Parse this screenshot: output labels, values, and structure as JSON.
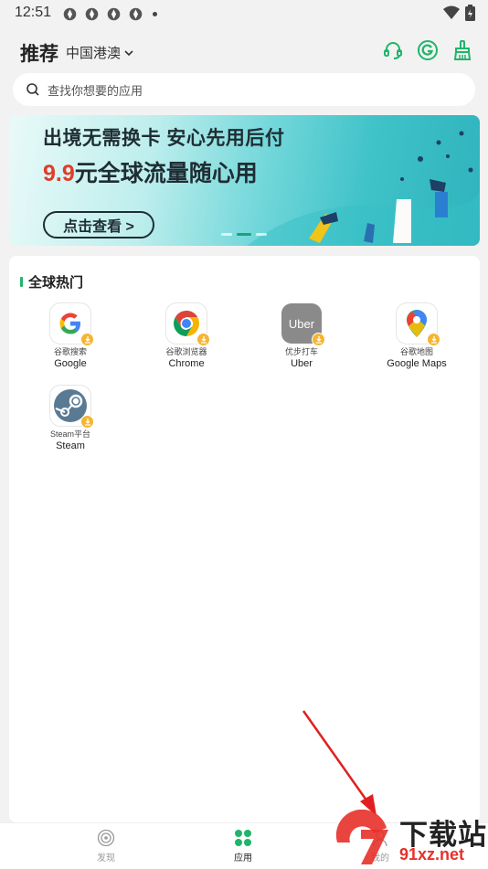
{
  "status_bar": {
    "time": "12:51"
  },
  "header": {
    "title": "推荐",
    "region": "中国港澳"
  },
  "search": {
    "placeholder": "查找你想要的应用"
  },
  "banner": {
    "line1": "出境无需换卡 安心先用后付",
    "line2_num": "9.9",
    "line2_rest": "元全球流量随心用",
    "cta": "点击查看 >"
  },
  "section": {
    "title": "全球热门"
  },
  "apps": [
    {
      "cn": "谷歌搜索",
      "en": "Google",
      "icon": "google-icon"
    },
    {
      "cn": "谷歌浏览器",
      "en": "Chrome",
      "icon": "chrome-icon"
    },
    {
      "cn": "优步打车",
      "en": "Uber",
      "icon": "uber-icon",
      "icon_text": "Uber"
    },
    {
      "cn": "谷歌地图",
      "en": "Google Maps",
      "icon": "google-maps-icon"
    },
    {
      "cn": "Steam平台",
      "en": "Steam",
      "icon": "steam-icon"
    }
  ],
  "tabs": [
    {
      "label": "发现",
      "icon": "discover-icon"
    },
    {
      "label": "应用",
      "icon": "apps-icon",
      "active": true
    },
    {
      "label": "我的",
      "icon": "profile-icon"
    }
  ],
  "watermark": {
    "text": "下载站",
    "url": "91xz.net"
  },
  "colors": {
    "accent": "#1fb56a",
    "badge": "#f5b532",
    "arrow": "#e02020"
  }
}
